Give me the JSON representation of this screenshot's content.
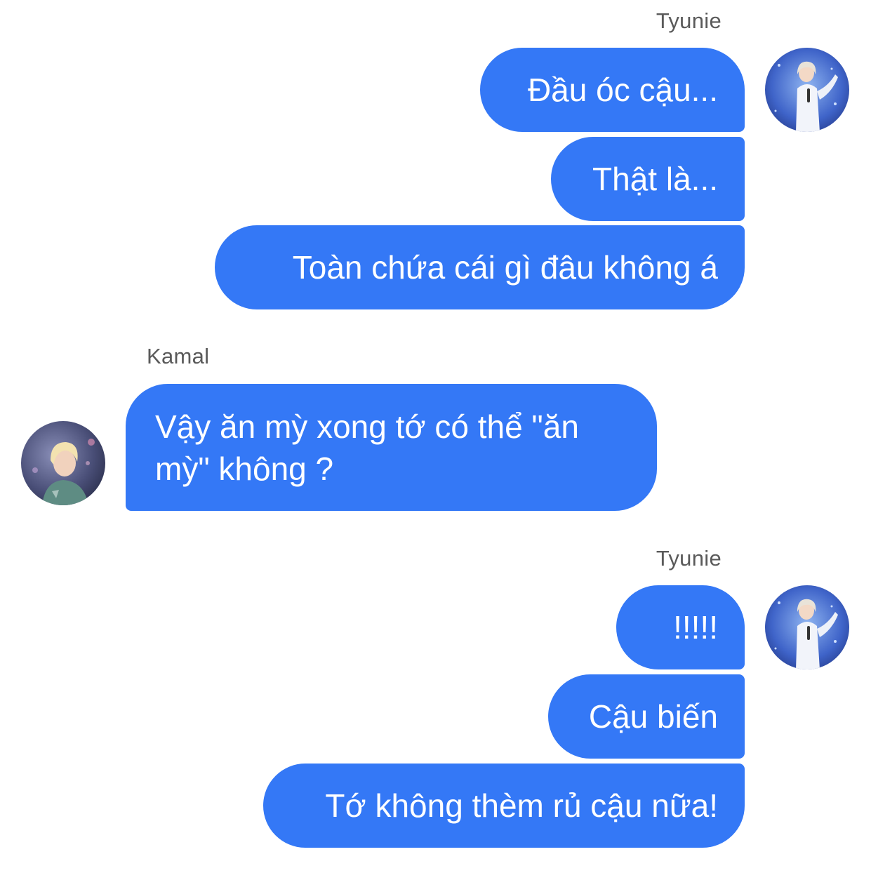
{
  "conversation": {
    "groups": [
      {
        "sender": "Tyunie",
        "side": "right",
        "messages": [
          "Đầu óc cậu...",
          "Thật là...",
          "Toàn chứa cái gì đâu không á"
        ]
      },
      {
        "sender": "Kamal",
        "side": "left",
        "messages": [
          "Vậy ăn mỳ xong tớ có thể \"ăn mỳ\" không ?"
        ]
      },
      {
        "sender": "Tyunie",
        "side": "right",
        "messages": [
          "!!!!!",
          "Cậu biến",
          "Tớ không thèm rủ cậu nữa!"
        ]
      }
    ]
  },
  "colors": {
    "bubble": "#3478f6",
    "bubble_text": "#ffffff",
    "sender_name": "#5a5a5a",
    "background": "#ffffff"
  },
  "avatars": {
    "tyunie": "avatar-photo-stage-white-outfit",
    "kamal": "avatar-photo-blond-hair-teal-shirt"
  }
}
